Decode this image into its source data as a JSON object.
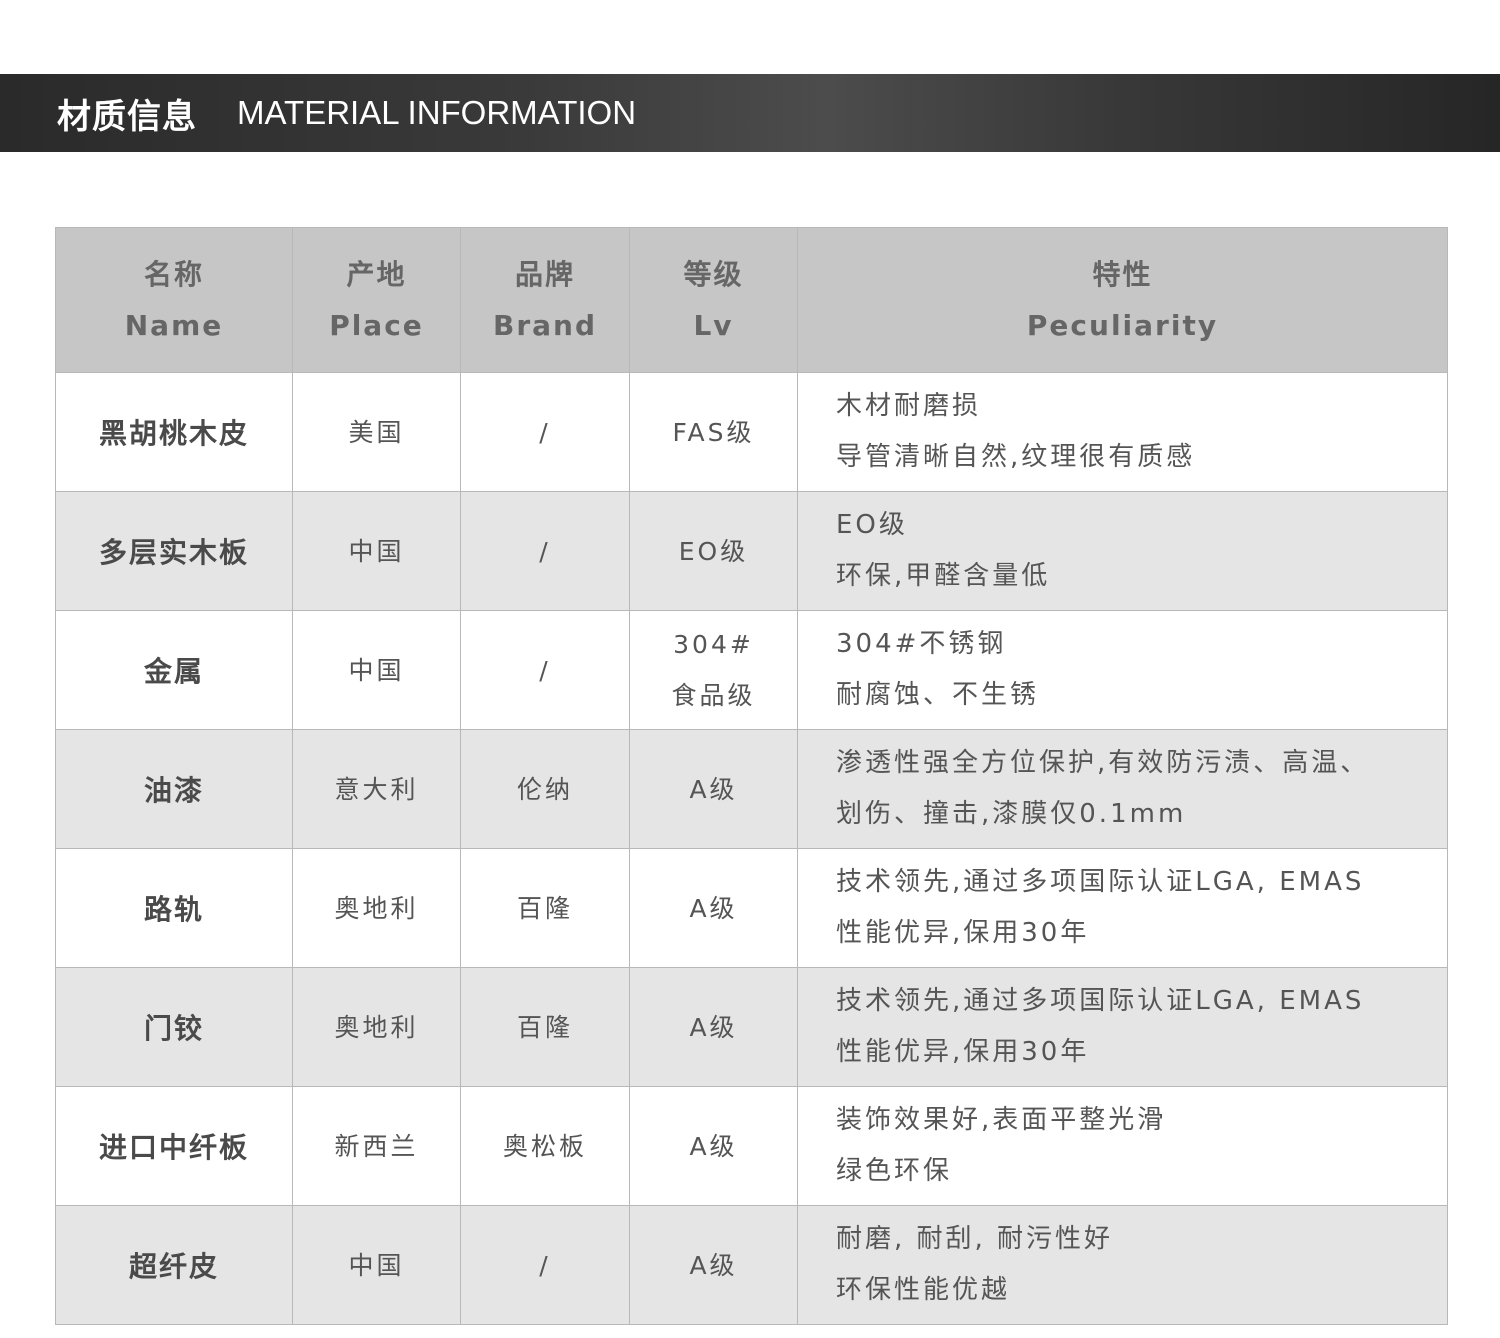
{
  "header": {
    "title_cn": "材质信息",
    "title_en": "MATERIAL INFORMATION"
  },
  "table": {
    "columns": [
      {
        "cn": "名称",
        "en": "Name"
      },
      {
        "cn": "产地",
        "en": "Place"
      },
      {
        "cn": "品牌",
        "en": "Brand"
      },
      {
        "cn": "等级",
        "en": "Lv"
      },
      {
        "cn": "特性",
        "en": "Peculiarity"
      }
    ],
    "rows": [
      {
        "name": "黑胡桃木皮",
        "place": "美国",
        "brand": "/",
        "lv": [
          "FAS级"
        ],
        "peculiarity": [
          "木材耐磨损",
          "导管清晰自然,纹理很有质感"
        ]
      },
      {
        "name": "多层实木板",
        "place": "中国",
        "brand": "/",
        "lv": [
          "EO级"
        ],
        "peculiarity": [
          "EO级",
          "环保,甲醛含量低"
        ]
      },
      {
        "name": "金属",
        "place": "中国",
        "brand": "/",
        "lv": [
          "304#",
          "食品级"
        ],
        "peculiarity": [
          "304#不锈钢",
          "耐腐蚀、不生锈"
        ]
      },
      {
        "name": "油漆",
        "place": "意大利",
        "brand": "伦纳",
        "lv": [
          "A级"
        ],
        "peculiarity": [
          "渗透性强全方位保护,有效防污渍、高温、",
          "划伤、撞击,漆膜仅0.1mm"
        ]
      },
      {
        "name": "路轨",
        "place": "奥地利",
        "brand": "百隆",
        "lv": [
          "A级"
        ],
        "peculiarity": [
          "技术领先,通过多项国际认证LGA, EMAS",
          "性能优异,保用30年"
        ]
      },
      {
        "name": "门铰",
        "place": "奥地利",
        "brand": "百隆",
        "lv": [
          "A级"
        ],
        "peculiarity": [
          "技术领先,通过多项国际认证LGA, EMAS",
          "性能优异,保用30年"
        ]
      },
      {
        "name": "进口中纤板",
        "place": "新西兰",
        "brand": "奥松板",
        "lv": [
          "A级"
        ],
        "peculiarity": [
          "装饰效果好,表面平整光滑",
          "绿色环保"
        ]
      },
      {
        "name": "超纤皮",
        "place": "中国",
        "brand": "/",
        "lv": [
          "A级"
        ],
        "peculiarity": [
          "耐磨, 耐刮, 耐污性好",
          "环保性能优越"
        ]
      }
    ]
  }
}
